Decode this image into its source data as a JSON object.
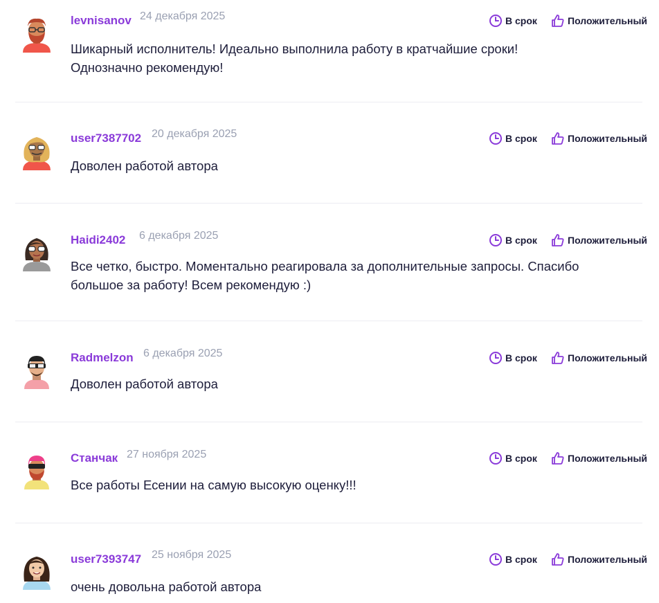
{
  "labels": {
    "on_time": "В срок",
    "positive": "Положительный"
  },
  "colors": {
    "accent": "#8a3ad9",
    "date": "#9aa0b2",
    "text": "#1d1d3a",
    "divider": "#ececf2"
  },
  "reviews": [
    {
      "username": "levnisanov",
      "date": "24 декабря 2025",
      "line1": "Шикарный исполнитель! Идеально выполнила работу в кратчайшие сроки!",
      "line2": "Однозначно рекомендую!"
    },
    {
      "username": "user7387702",
      "date": "20 декабря 2025",
      "line1": "Доволен работой автора",
      "line2": ""
    },
    {
      "username": "Haidi2402",
      "date": "6 декабря 2025",
      "line1": "Все четко, быстро. Моментально реагировала за дополнительные запросы. Спасибо",
      "line2": "большое за работу! Всем рекомендую :)"
    },
    {
      "username": "Radmelzon",
      "date": "6 декабря 2025",
      "line1": "Доволен работой автора",
      "line2": ""
    },
    {
      "username": "Станчак",
      "date": "27 ноября 2025",
      "line1": "Все работы Есении на самую высокую оценку!!!",
      "line2": ""
    },
    {
      "username": "user7393747",
      "date": "25 ноября 2025",
      "line1": "очень довольна работой автора",
      "line2": ""
    }
  ]
}
